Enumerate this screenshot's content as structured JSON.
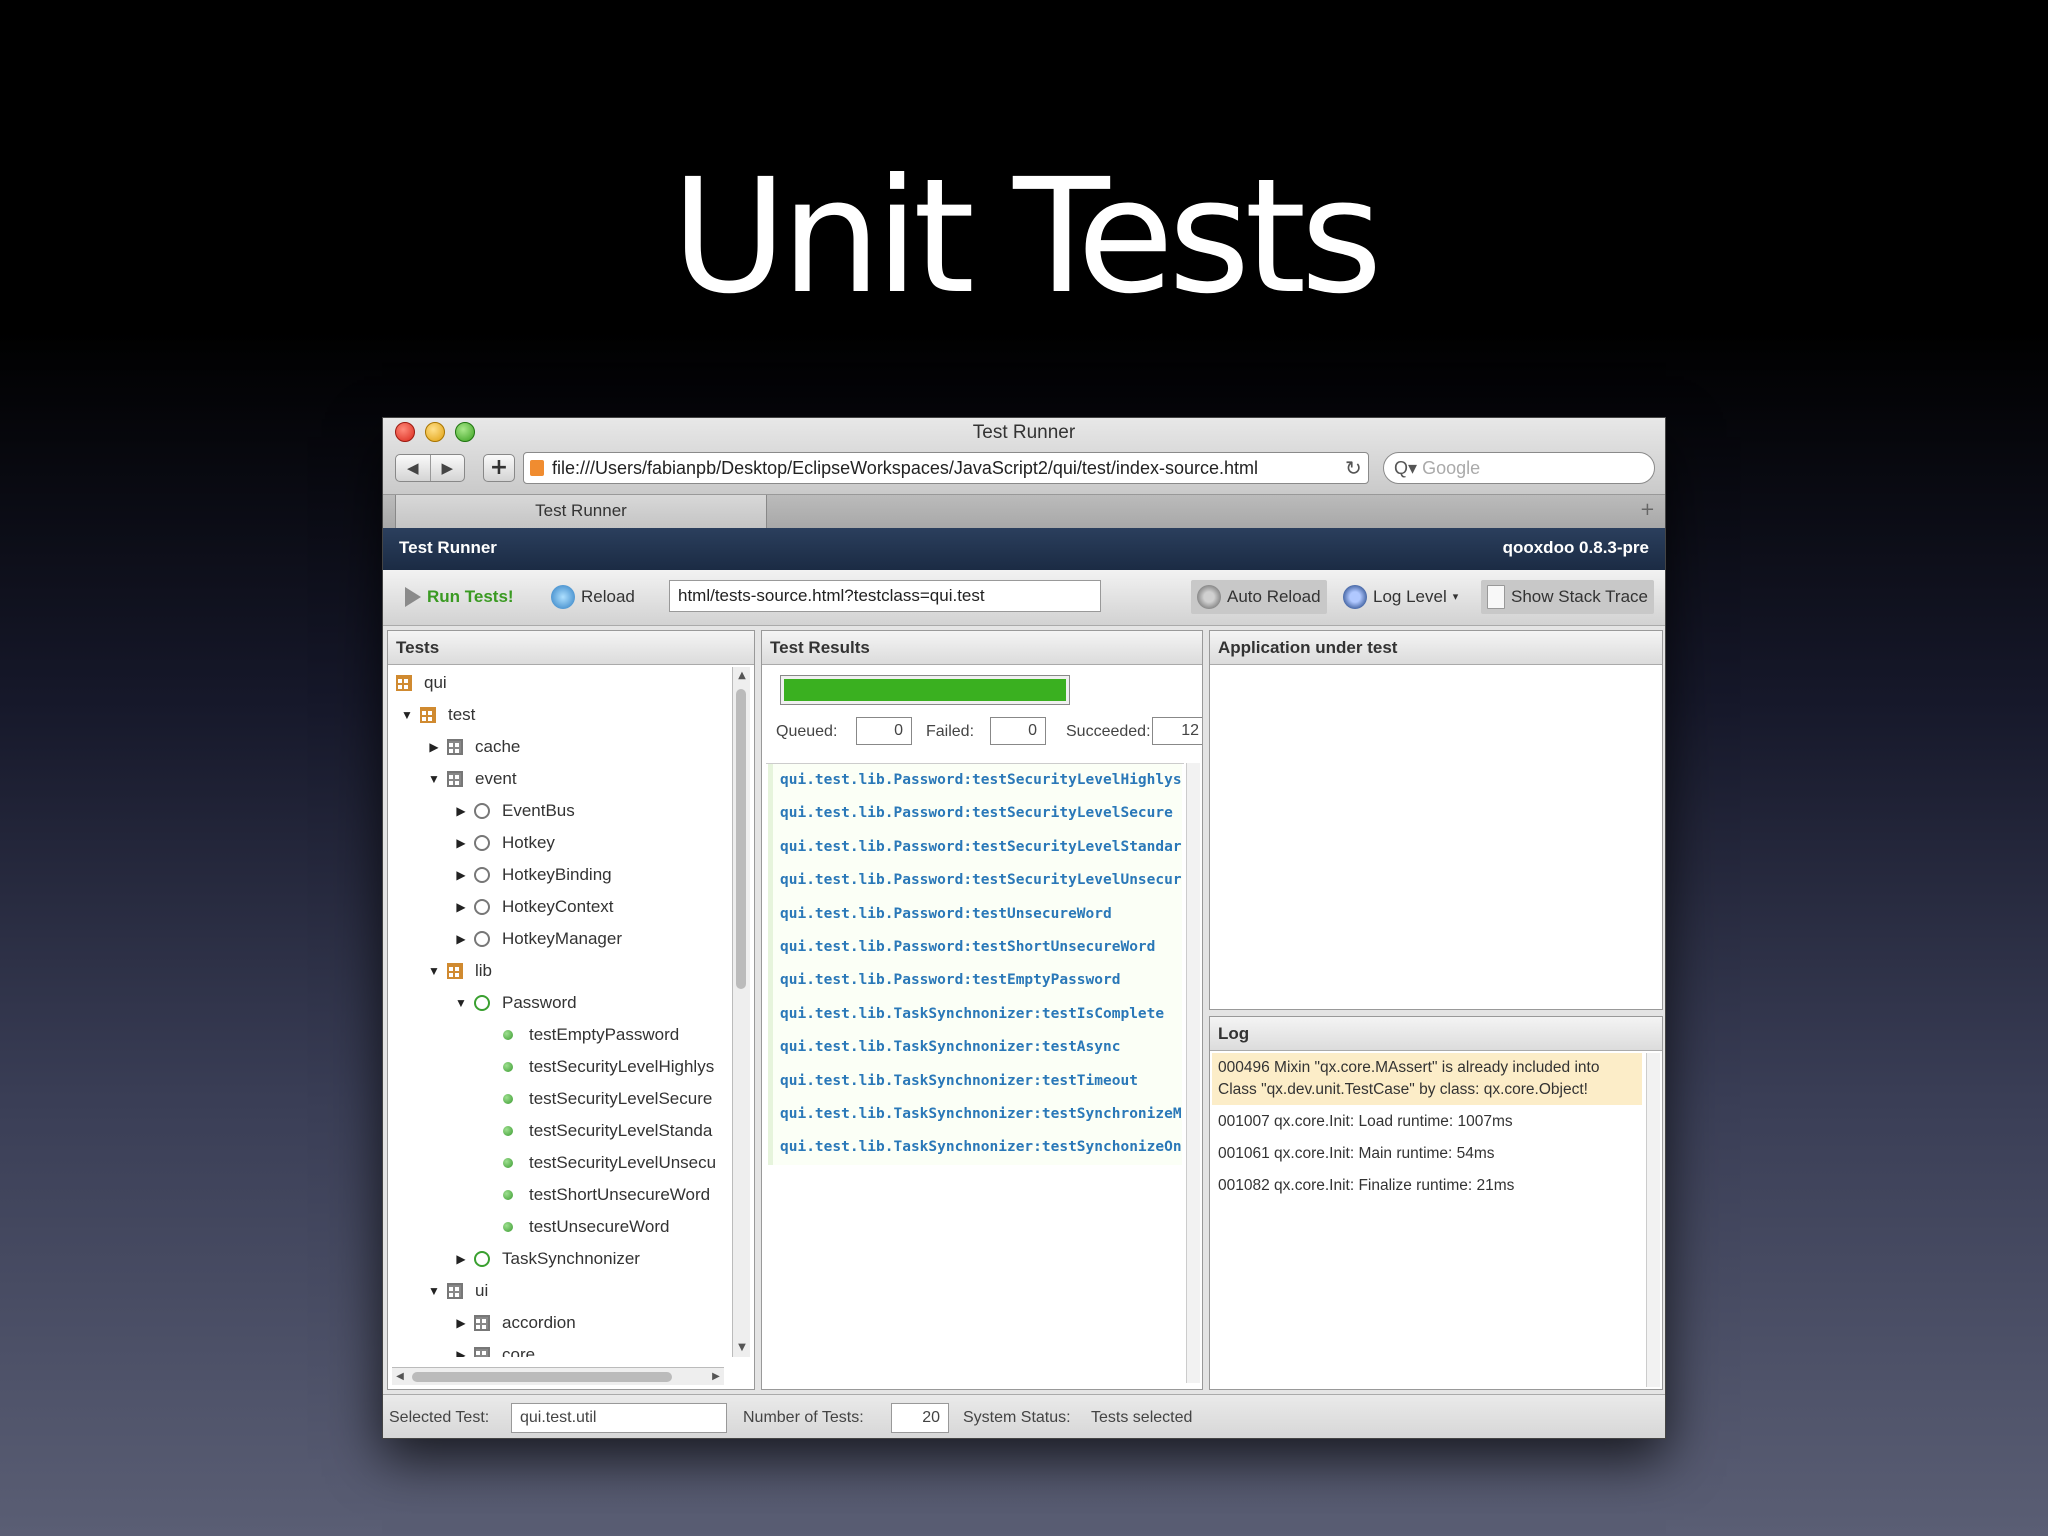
{
  "slide": {
    "title": "Unit Tests"
  },
  "browser": {
    "window_title": "Test Runner",
    "nav_back": "◀",
    "nav_forward": "▶",
    "new_tab": "+",
    "url": "file:///Users/fabianpb/Desktop/EclipseWorkspaces/JavaScript2/qui/test/index-source.html",
    "reload_glyph": "↻",
    "search_placeholder": "Google",
    "search_glyph": "Q▾",
    "tab_label": "Test Runner",
    "tab_add": "+"
  },
  "app": {
    "header_title": "Test Runner",
    "header_version": "qooxdoo 0.8.3-pre",
    "toolbar": {
      "run_label": "Run Tests!",
      "reload_label": "Reload",
      "test_url": "html/tests-source.html?testclass=qui.test",
      "auto_reload_label": "Auto Reload",
      "log_level_label": "Log Level",
      "log_level_caret": "▾",
      "stack_trace_label": "Show Stack Trace"
    },
    "tests_panel": {
      "title": "Tests",
      "tree": [
        {
          "label": "qui",
          "depth": 0,
          "arrow": "",
          "icon": "package-orange"
        },
        {
          "label": "test",
          "depth": 0,
          "arrow": "▼",
          "icon": "package-orange"
        },
        {
          "label": "cache",
          "depth": 1,
          "arrow": "▶",
          "icon": "package-gray"
        },
        {
          "label": "event",
          "depth": 1,
          "arrow": "▼",
          "icon": "package-gray"
        },
        {
          "label": "EventBus",
          "depth": 2,
          "arrow": "▶",
          "icon": "class-gray"
        },
        {
          "label": "Hotkey",
          "depth": 2,
          "arrow": "▶",
          "icon": "class-gray"
        },
        {
          "label": "HotkeyBinding",
          "depth": 2,
          "arrow": "▶",
          "icon": "class-gray"
        },
        {
          "label": "HotkeyContext",
          "depth": 2,
          "arrow": "▶",
          "icon": "class-gray"
        },
        {
          "label": "HotkeyManager",
          "depth": 2,
          "arrow": "▶",
          "icon": "class-gray"
        },
        {
          "label": "lib",
          "depth": 1,
          "arrow": "▼",
          "icon": "package-orange"
        },
        {
          "label": "Password",
          "depth": 2,
          "arrow": "▼",
          "icon": "class-green"
        },
        {
          "label": "testEmptyPassword",
          "depth": 3,
          "arrow": "",
          "icon": "test-dot"
        },
        {
          "label": "testSecurityLevelHighlys",
          "depth": 3,
          "arrow": "",
          "icon": "test-dot"
        },
        {
          "label": "testSecurityLevelSecure",
          "depth": 3,
          "arrow": "",
          "icon": "test-dot"
        },
        {
          "label": "testSecurityLevelStanda",
          "depth": 3,
          "arrow": "",
          "icon": "test-dot"
        },
        {
          "label": "testSecurityLevelUnsecu",
          "depth": 3,
          "arrow": "",
          "icon": "test-dot"
        },
        {
          "label": "testShortUnsecureWord",
          "depth": 3,
          "arrow": "",
          "icon": "test-dot"
        },
        {
          "label": "testUnsecureWord",
          "depth": 3,
          "arrow": "",
          "icon": "test-dot"
        },
        {
          "label": "TaskSynchnonizer",
          "depth": 2,
          "arrow": "▶",
          "icon": "class-green"
        },
        {
          "label": "ui",
          "depth": 1,
          "arrow": "▼",
          "icon": "package-gray"
        },
        {
          "label": "accordion",
          "depth": 2,
          "arrow": "▶",
          "icon": "package-gray"
        },
        {
          "label": "core",
          "depth": 2,
          "arrow": "▶",
          "icon": "package-gray"
        }
      ]
    },
    "results_panel": {
      "title": "Test Results",
      "progress_fraction": 1.0,
      "queued_label": "Queued:",
      "queued": "0",
      "failed_label": "Failed:",
      "failed": "0",
      "succeeded_label": "Succeeded:",
      "succeeded": "12",
      "results": [
        "qui.test.lib.Password:testSecurityLevelHighlysecure",
        "qui.test.lib.Password:testSecurityLevelSecure",
        "qui.test.lib.Password:testSecurityLevelStandard",
        "qui.test.lib.Password:testSecurityLevelUnsecure",
        "qui.test.lib.Password:testUnsecureWord",
        "qui.test.lib.Password:testShortUnsecureWord",
        "qui.test.lib.Password:testEmptyPassword",
        "qui.test.lib.TaskSynchnonizer:testIsComplete",
        "qui.test.lib.TaskSynchnonizer:testAsync",
        "qui.test.lib.TaskSynchnonizer:testTimeout",
        "qui.test.lib.TaskSynchnonizer:testSynchronizeMany",
        "qui.test.lib.TaskSynchnonizer:testSynchonizeOne"
      ]
    },
    "app_panel": {
      "title": "Application under test"
    },
    "log_panel": {
      "title": "Log",
      "entries": [
        {
          "text": "000496 Mixin \"qx.core.MAssert\" is already included into Class \"qx.dev.unit.TestCase\" by class: qx.core.Object!",
          "level": "warn"
        },
        {
          "text": "001007 qx.core.Init: Load runtime: 1007ms",
          "level": "info"
        },
        {
          "text": "001061 qx.core.Init: Main runtime: 54ms",
          "level": "info"
        },
        {
          "text": "001082 qx.core.Init: Finalize runtime: 21ms",
          "level": "info"
        }
      ]
    },
    "statusbar": {
      "selected_label": "Selected Test:",
      "selected_value": "qui.test.util",
      "count_label": "Number of Tests:",
      "count_value": "20",
      "status_label": "System Status:",
      "status_value": "Tests selected"
    }
  },
  "colors": {
    "header_bg": "#1b2b44",
    "progress": "#3ab020",
    "result_text": "#2a78b8",
    "run_green": "#3a9a22"
  }
}
